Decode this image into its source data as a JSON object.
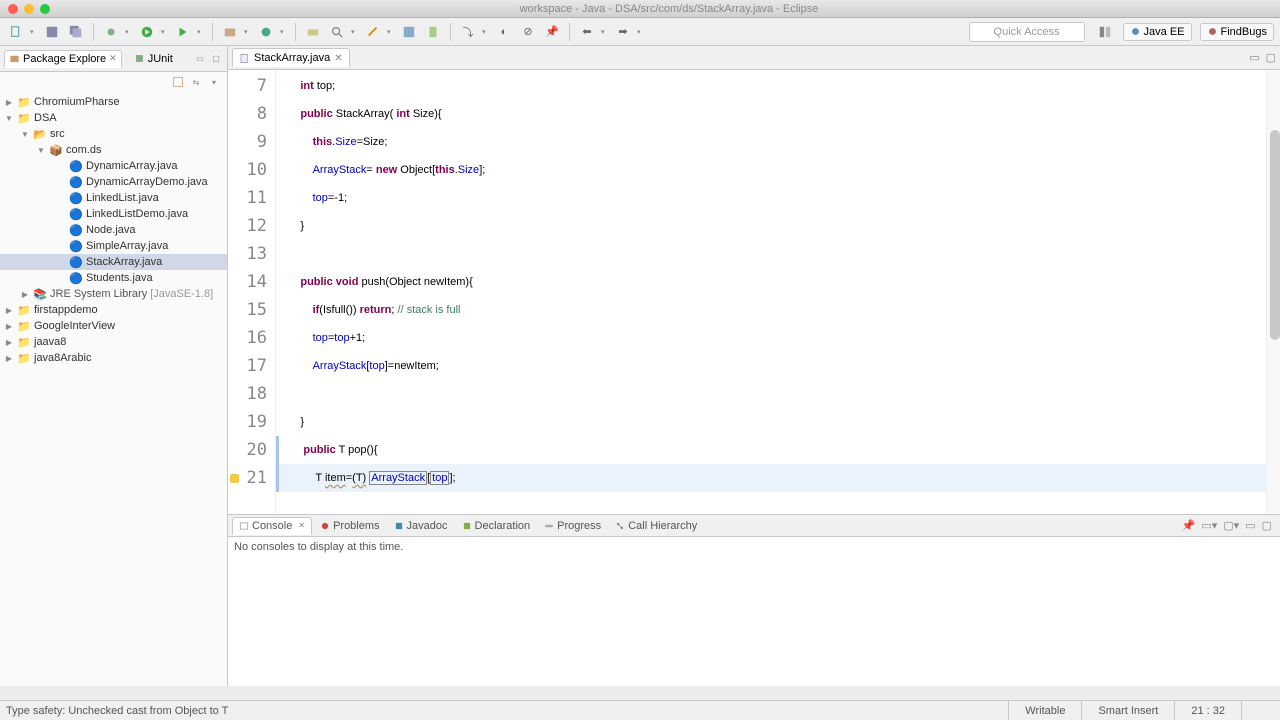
{
  "window": {
    "title": "workspace - Java - DSA/src/com/ds/StackArray.java - Eclipse"
  },
  "toolbar": {
    "quick_access": "Quick Access",
    "persp_javaee": "Java EE",
    "persp_findbugs": "FindBugs"
  },
  "left": {
    "tab_package": "Package Explore",
    "tab_junit": "JUnit",
    "projects": {
      "0": "ChromiumPharse",
      "1": "DSA",
      "src": "src",
      "pkg": "com.ds",
      "files": {
        "0": "DynamicArray.java",
        "1": "DynamicArrayDemo.java",
        "2": "LinkedList.java",
        "3": "LinkedListDemo.java",
        "4": "Node.java",
        "5": "SimpleArray.java",
        "6": "StackArray.java",
        "7": "Students.java"
      },
      "jre": "JRE System Library",
      "jrever": "[JavaSE-1.8]",
      "2": "firstappdemo",
      "3": "GoogleInterView",
      "4": "jaava8",
      "5": "java8Arabic"
    }
  },
  "editor": {
    "tab": "StackArray.java",
    "lines": {
      "7": {
        "n": "7",
        "segs": [
          {
            "t": "      "
          },
          {
            "t": "int",
            "c": "kw"
          },
          {
            "t": " top;"
          }
        ]
      },
      "8": {
        "n": "8",
        "segs": [
          {
            "t": "      "
          },
          {
            "t": "public",
            "c": "kw"
          },
          {
            "t": " StackArray( "
          },
          {
            "t": "int",
            "c": "kw"
          },
          {
            "t": " Size){"
          }
        ]
      },
      "9": {
        "n": "9",
        "segs": [
          {
            "t": "          "
          },
          {
            "t": "this",
            "c": "kw"
          },
          {
            "t": "."
          },
          {
            "t": "Size",
            "c": "field"
          },
          {
            "t": "=Size;"
          }
        ]
      },
      "10": {
        "n": "10",
        "segs": [
          {
            "t": "          "
          },
          {
            "t": "ArrayStack",
            "c": "field"
          },
          {
            "t": "= "
          },
          {
            "t": "new",
            "c": "kw"
          },
          {
            "t": " Object["
          },
          {
            "t": "this",
            "c": "kw"
          },
          {
            "t": "."
          },
          {
            "t": "Size",
            "c": "field"
          },
          {
            "t": "];"
          }
        ]
      },
      "11": {
        "n": "11",
        "segs": [
          {
            "t": "          "
          },
          {
            "t": "top",
            "c": "field"
          },
          {
            "t": "=-1;"
          }
        ]
      },
      "12": {
        "n": "12",
        "segs": [
          {
            "t": "      }"
          }
        ]
      },
      "13": {
        "n": "13",
        "segs": [
          {
            "t": " "
          }
        ]
      },
      "14": {
        "n": "14",
        "segs": [
          {
            "t": "      "
          },
          {
            "t": "public",
            "c": "kw"
          },
          {
            "t": " "
          },
          {
            "t": "void",
            "c": "kw"
          },
          {
            "t": " push(Object newItem){"
          }
        ]
      },
      "15": {
        "n": "15",
        "segs": [
          {
            "t": "          "
          },
          {
            "t": "if",
            "c": "kw"
          },
          {
            "t": "(Isfull()) "
          },
          {
            "t": "return",
            "c": "kw"
          },
          {
            "t": "; "
          },
          {
            "t": "// stack is full",
            "c": "cm"
          }
        ]
      },
      "16": {
        "n": "16",
        "segs": [
          {
            "t": "          "
          },
          {
            "t": "top",
            "c": "field"
          },
          {
            "t": "="
          },
          {
            "t": "top",
            "c": "field"
          },
          {
            "t": "+1;"
          }
        ]
      },
      "17": {
        "n": "17",
        "segs": [
          {
            "t": "          "
          },
          {
            "t": "ArrayStack",
            "c": "field"
          },
          {
            "t": "["
          },
          {
            "t": "top",
            "c": "field"
          },
          {
            "t": "]=newItem;"
          }
        ]
      },
      "18": {
        "n": "18",
        "segs": [
          {
            "t": " "
          }
        ]
      },
      "19": {
        "n": "19",
        "segs": [
          {
            "t": "      }"
          }
        ]
      },
      "20": {
        "n": "20",
        "segs": [
          {
            "t": "      "
          },
          {
            "t": "public",
            "c": "kw"
          },
          {
            "t": " T pop(){"
          }
        ]
      },
      "21": {
        "n": "21",
        "segs": [
          {
            "t": "          T "
          },
          {
            "t": "item",
            "c": "uscore"
          },
          {
            "t": "="
          },
          {
            "t": "(T)",
            "c": "uscore"
          },
          {
            "t": " "
          },
          {
            "t": "ArrayStack",
            "c": "field box"
          },
          {
            "t": "["
          },
          {
            "t": "top",
            "c": "field box"
          },
          {
            "t": "];"
          }
        ]
      }
    }
  },
  "bottom": {
    "tabs": {
      "0": "Console",
      "1": "Problems",
      "2": "Javadoc",
      "3": "Declaration",
      "4": "Progress",
      "5": "Call Hierarchy"
    },
    "message": "No consoles to display at this time."
  },
  "status": {
    "msg": "Type safety: Unchecked cast from Object to T",
    "writable": "Writable",
    "insert": "Smart Insert",
    "pos": "21 : 32"
  }
}
